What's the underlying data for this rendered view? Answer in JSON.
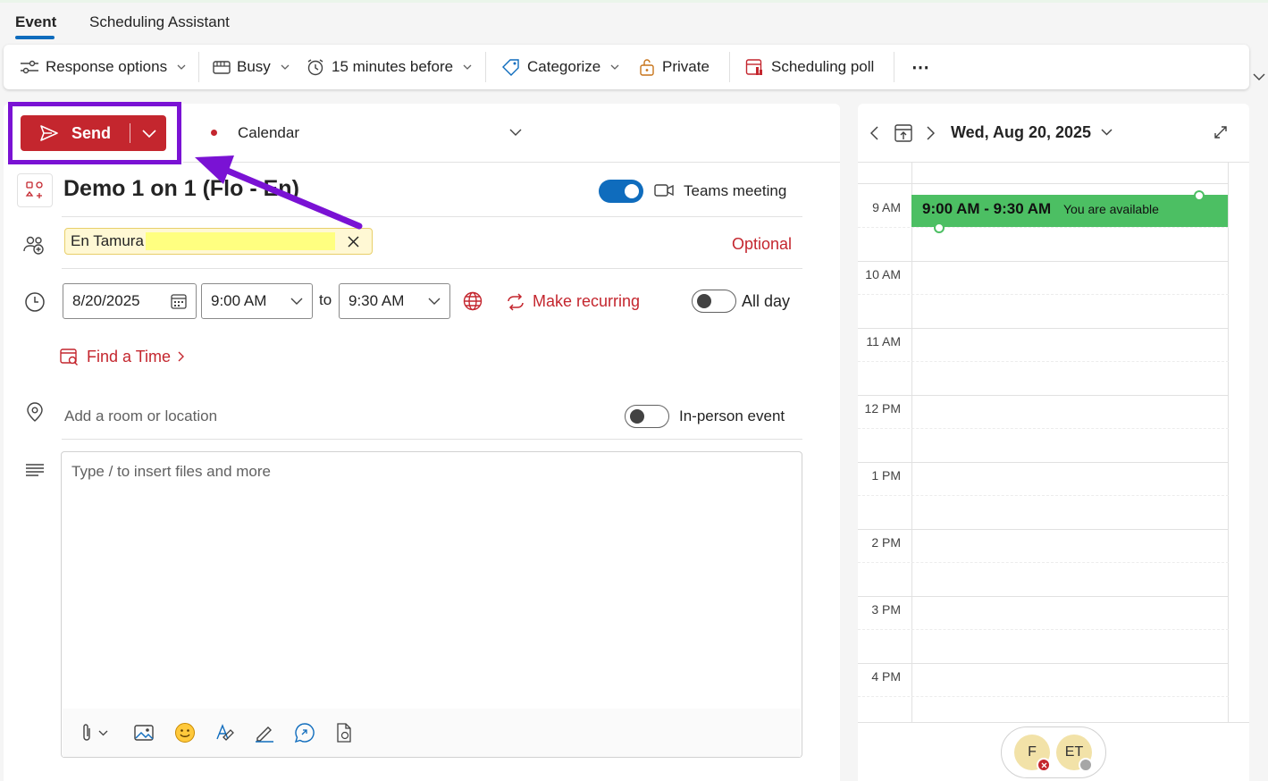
{
  "tabs": [
    {
      "label": "Event",
      "active": true
    },
    {
      "label": "Scheduling Assistant",
      "active": false
    }
  ],
  "toolbar": {
    "response_options": "Response options",
    "busy": "Busy",
    "reminder": "15 minutes before",
    "categorize": "Categorize",
    "private": "Private",
    "scheduling_poll": "Scheduling poll",
    "more": "⋯"
  },
  "compose": {
    "send_label": "Send",
    "calendar_label": "Calendar",
    "title": "Demo 1 on 1 (Flo - En)",
    "teams_meeting_label": "Teams meeting",
    "teams_meeting_on": true,
    "attendee": "En Tamura",
    "optional_label": "Optional",
    "start_date": "8/20/2025",
    "start_time": "9:00 AM",
    "to_label": "to",
    "end_time": "9:30 AM",
    "make_recurring": "Make recurring",
    "all_day_label": "All day",
    "all_day_on": false,
    "find_time": "Find a Time",
    "location_placeholder": "Add a room or location",
    "in_person_label": "In-person event",
    "in_person_on": false,
    "body_placeholder": "Type / to insert files and more"
  },
  "calendar": {
    "date": "Wed, Aug 20, 2025",
    "hours": [
      "9 AM",
      "10 AM",
      "11 AM",
      "12 PM",
      "1 PM",
      "2 PM",
      "3 PM",
      "4 PM"
    ],
    "event_time": "9:00 AM - 9:30 AM",
    "event_status": "You are available",
    "attendees": [
      {
        "initials": "F",
        "status": "declined"
      },
      {
        "initials": "ET",
        "status": "unknown"
      }
    ]
  },
  "colors": {
    "accent": "#0f6cbd",
    "send": "#c4262e",
    "highlight": "#7a12d4",
    "event": "#4cbf63"
  }
}
